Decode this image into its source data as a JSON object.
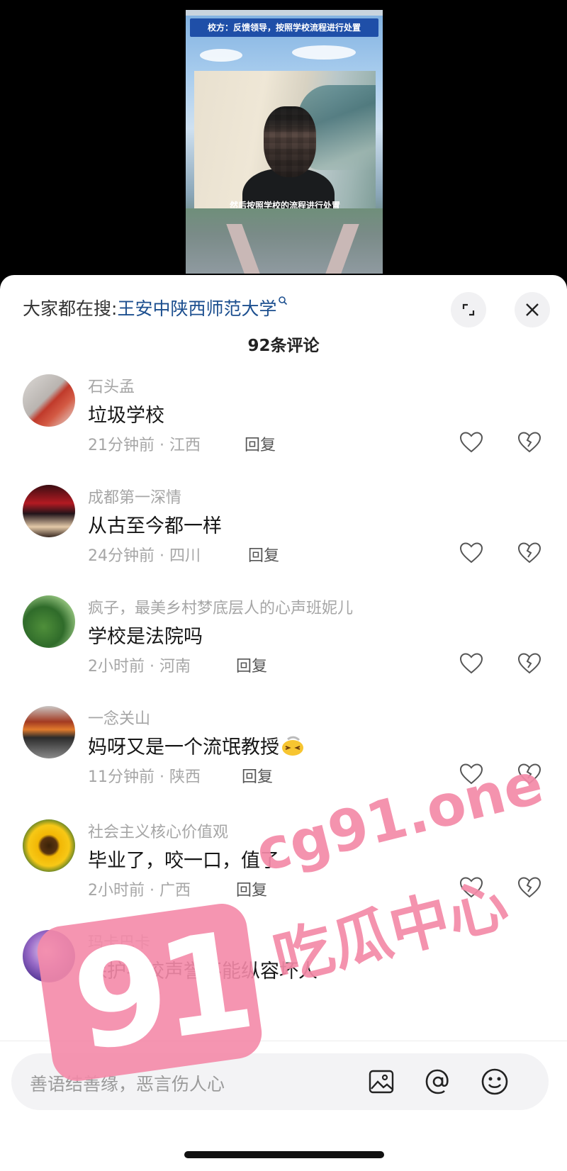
{
  "video": {
    "banner": "校方：反馈领导，按照学校流程进行处置",
    "caption": "然后按照学校的流程进行处置"
  },
  "sheet": {
    "search_prefix": "大家都在搜:",
    "search_term": "王安中陕西师范大学",
    "comment_count": "92条评论"
  },
  "comments": [
    {
      "author": "石头孟",
      "text": "垃圾学校",
      "time": "21分钟前 · 江西",
      "reply": "回复"
    },
    {
      "author": "成都第一深情",
      "text": "从古至今都一样",
      "time": "24分钟前 · 四川",
      "reply": "回复"
    },
    {
      "author": "疯子，最美乡村梦底层人的心声班妮儿",
      "text": "学校是法院吗",
      "time": "2小时前 · 河南",
      "reply": "回复"
    },
    {
      "author": "一念关山",
      "text": "妈呀又是一个流氓教授",
      "time": "11分钟前 · 陕西",
      "reply": "回复"
    },
    {
      "author": "社会主义核心价值观",
      "text": "毕业了，咬一口，值了",
      "time": "2小时前 · 广西",
      "reply": "回复"
    },
    {
      "author": "玛卡巴卡",
      "text": "保护学校声誉不能纵容坏人"
    }
  ],
  "input": {
    "placeholder": "善语结善缘，恶言伤人心"
  },
  "watermark": {
    "number": "91",
    "domain": "cg91.one",
    "name": "吃瓜中心"
  },
  "colors": {
    "link": "#1c4f8f",
    "watermark": "#f48aa8",
    "banner": "#1f4fa8"
  }
}
